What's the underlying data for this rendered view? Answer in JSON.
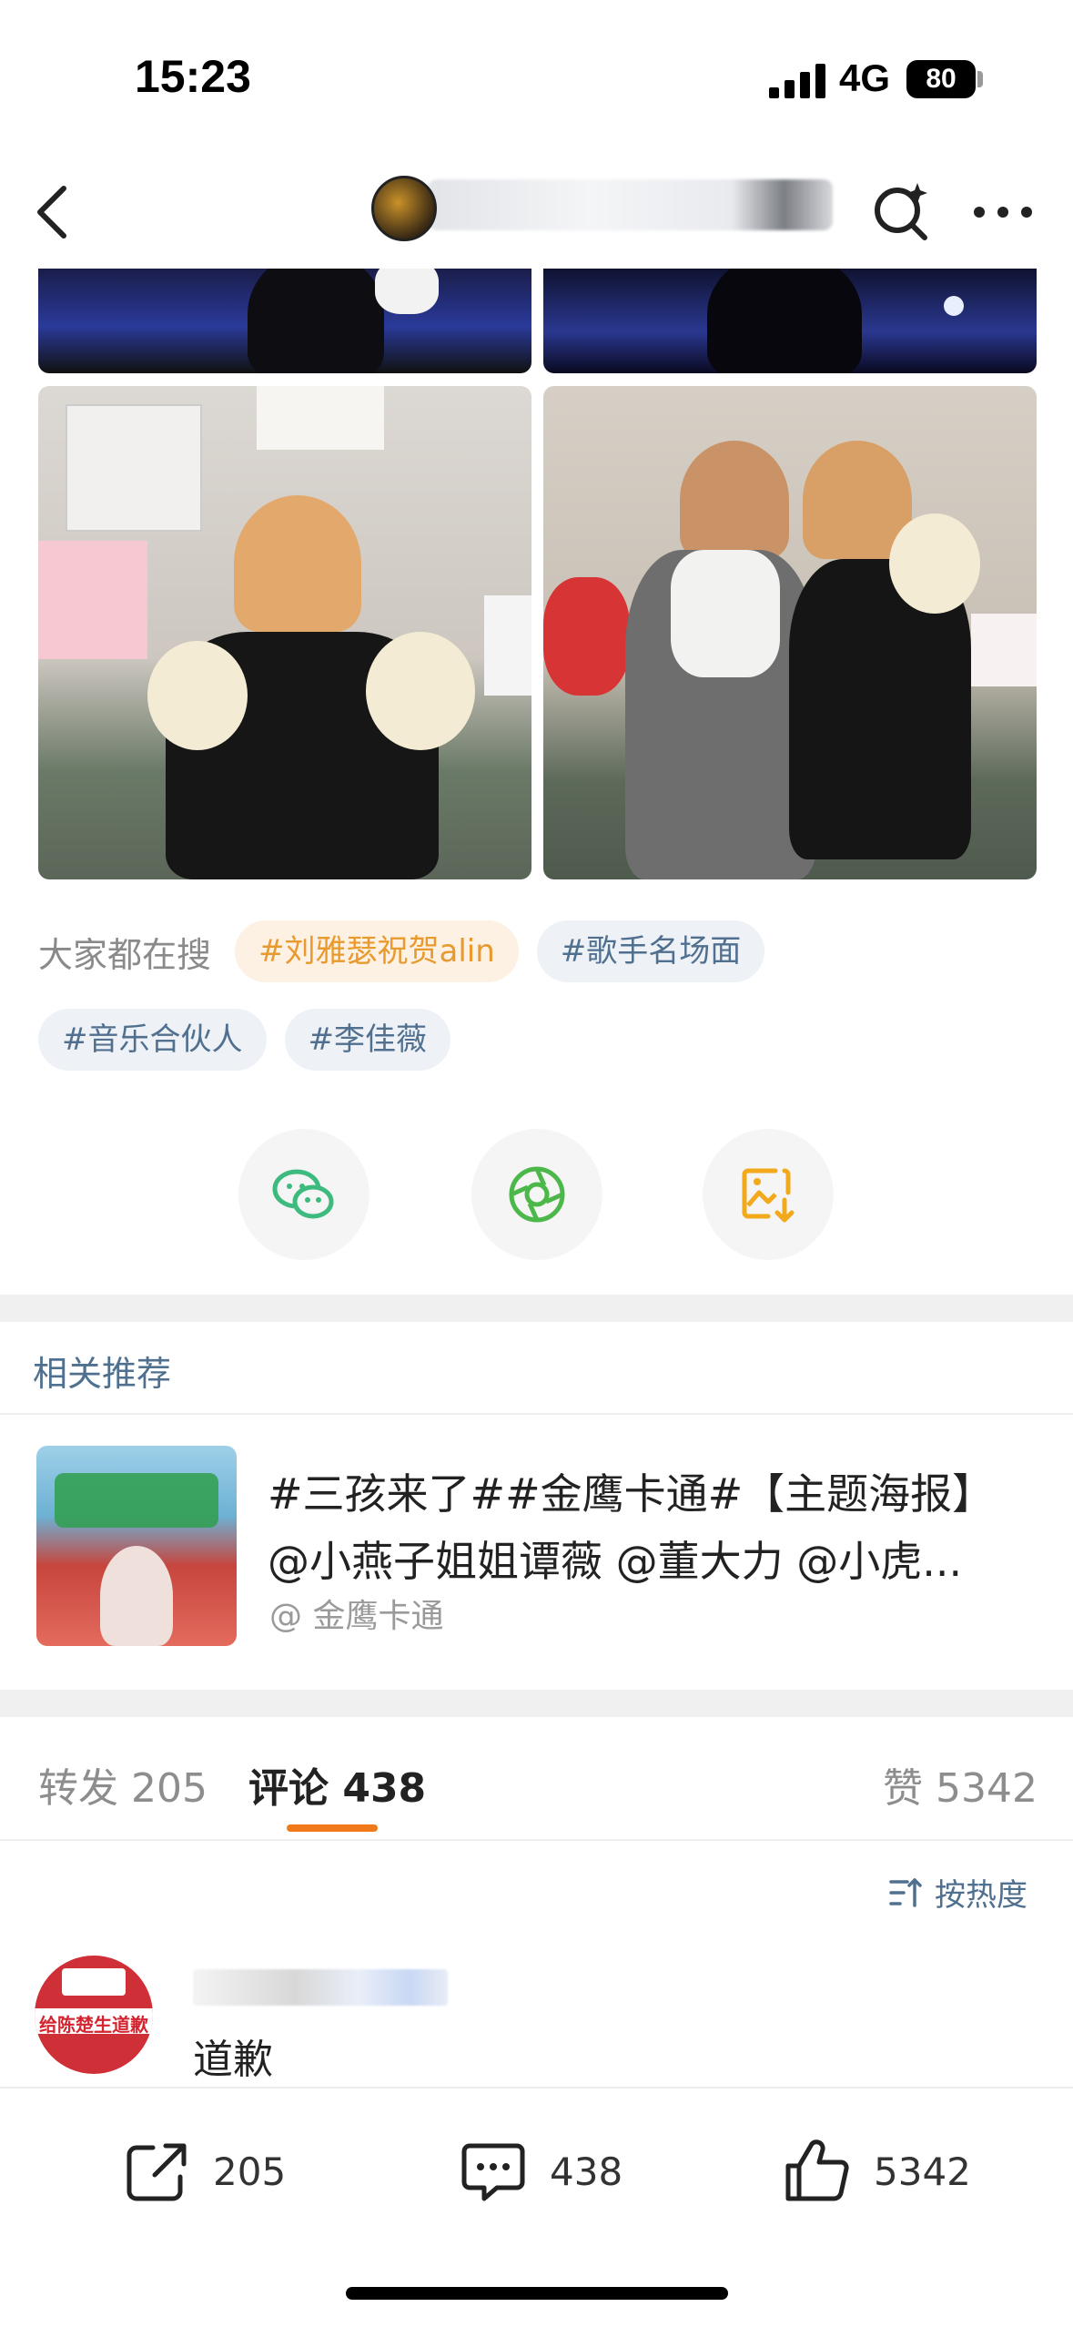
{
  "status_bar": {
    "time": "15:23",
    "network": "4G",
    "battery": "80"
  },
  "hot_search": {
    "label": "大家都在搜",
    "tags": [
      "#刘雅瑟祝贺alin",
      "#歌手名场面",
      "#音乐合伙人",
      "#李佳薇"
    ]
  },
  "share_icons": [
    "wechat-icon",
    "moments-icon",
    "save-image-icon"
  ],
  "related": {
    "title": "相关推荐",
    "post_line1": "#三孩来了##金鹰卡通#【主题海报】",
    "post_line2": "@小燕子姐姐谭薇 @董大力 @小虎...",
    "source": "@ 金鹰卡通"
  },
  "tabs": [
    {
      "label": "转发",
      "count": "205"
    },
    {
      "label": "评论",
      "count": "438"
    },
    {
      "label": "赞",
      "count": "5342"
    }
  ],
  "active_tab": "评论",
  "sort_label": "按热度",
  "comment": {
    "avatar_text": "给陈楚生道歉",
    "text": "道歉"
  },
  "actions": {
    "repost": "205",
    "comment": "438",
    "like": "5342"
  },
  "colors": {
    "accent": "#f07a1a",
    "link": "#50708f",
    "hot_tag": "#e99a2e"
  }
}
